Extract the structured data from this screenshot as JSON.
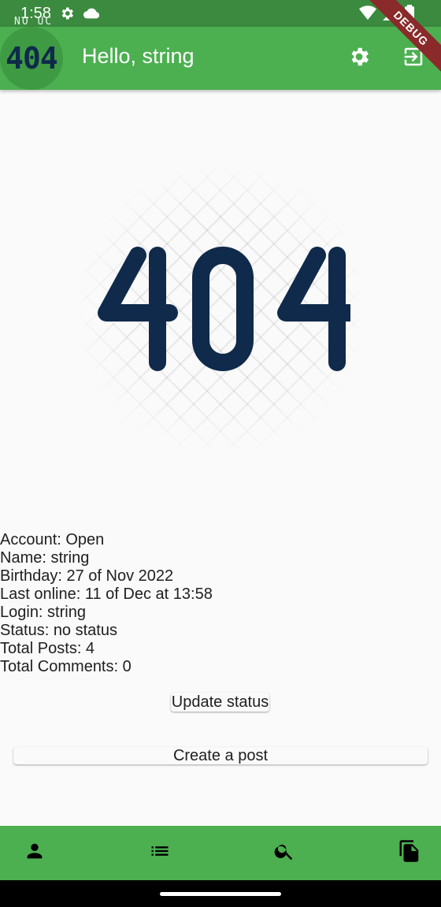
{
  "status_bar": {
    "time": "1:58",
    "icons": [
      "settings-icon",
      "cloud-icon",
      "wifi-icon",
      "cell-signal-icon",
      "battery-icon"
    ]
  },
  "debug_banner": "DEBUG",
  "app_bar": {
    "avatar_text": "404",
    "avatar_caption": "NO UC",
    "title": "Hello, string",
    "actions": [
      "gear-icon",
      "logout-icon"
    ]
  },
  "illustration": {
    "text": "404"
  },
  "profile": {
    "account": "Account: Open",
    "name": "Name: string",
    "birthday": "Birthday: 27 of Nov 2022",
    "last_online": "Last online: 11 of Dec at 13:58",
    "login": "Login: string",
    "status": "Status: no status",
    "total_posts": "Total Posts: 4",
    "total_comments": "Total Comments: 0"
  },
  "buttons": {
    "update_status": "Update status",
    "create_post": "Create a post"
  },
  "bottom_nav": {
    "items": [
      "person-icon",
      "list-icon",
      "search-icon",
      "documents-icon"
    ]
  },
  "colors": {
    "status_bar": "#3b8a3f",
    "app_bar": "#4caf50",
    "nav_bar": "#4caf50",
    "ribbon": "#8a2a2a",
    "illustration_text": "#0f2a4a"
  }
}
